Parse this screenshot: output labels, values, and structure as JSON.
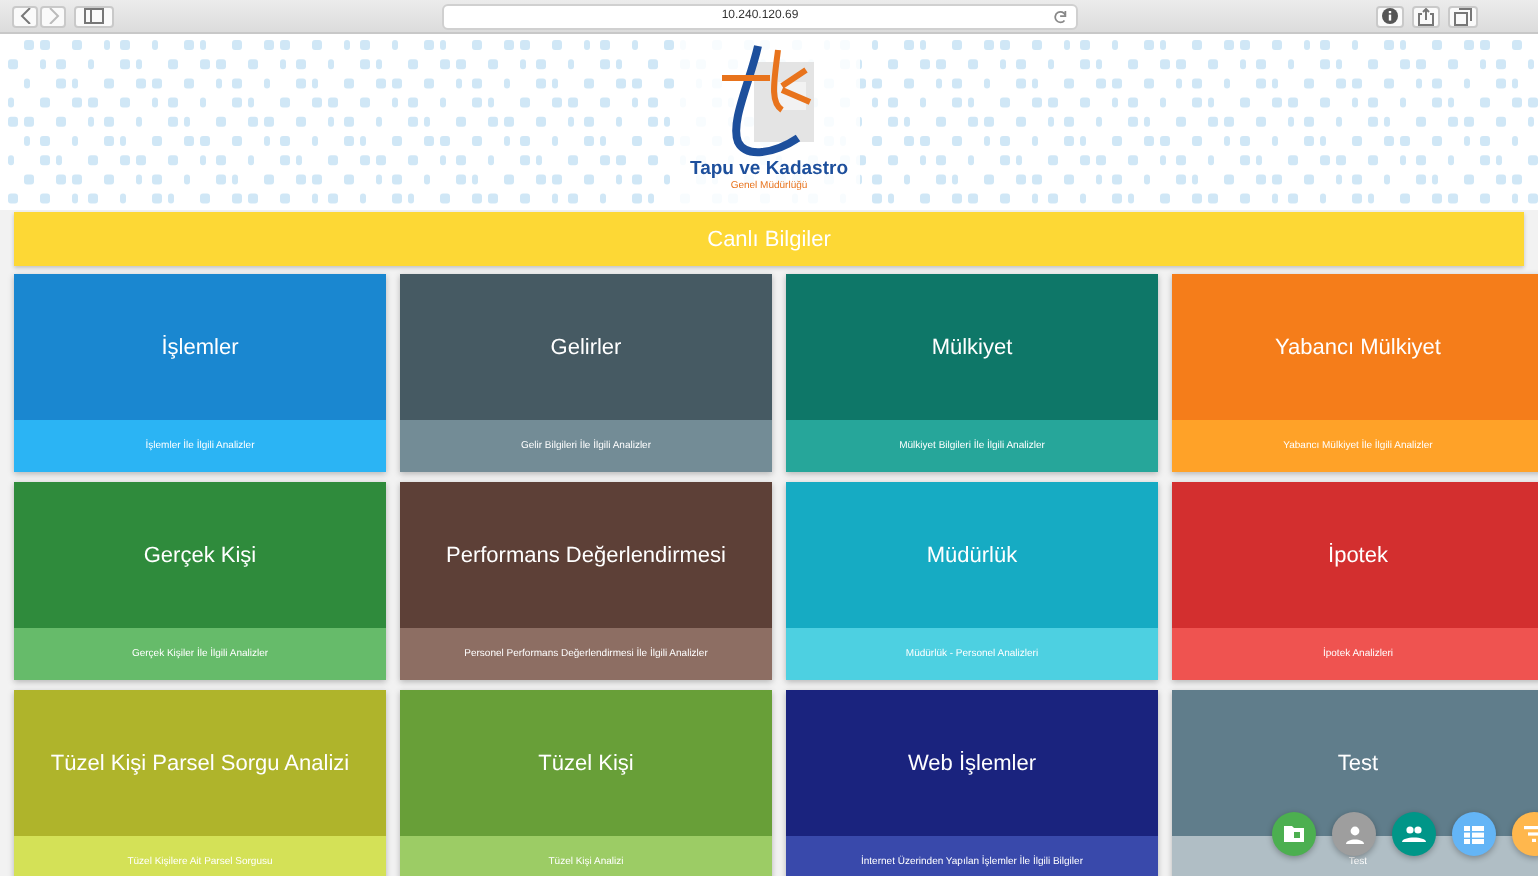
{
  "browser": {
    "url": "10.240.120.69"
  },
  "header": {
    "logo_title": "Tapu ve Kadastro",
    "logo_subtitle": "Genel Müdürlüğü"
  },
  "live_bar": {
    "label": "Canlı Bilgiler"
  },
  "tiles": [
    {
      "title": "İşlemler",
      "color": "#1a87d0",
      "footer": {
        "subtitle": "İşlemler İle İlgili Analizler",
        "color": "#2bb4f4"
      }
    },
    {
      "title": "Gelirler",
      "color": "#465a63",
      "footer": {
        "subtitle": "Gelir Bilgileri İle İlgili Analizler",
        "color": "#738c96"
      }
    },
    {
      "title": "Mülkiyet",
      "color": "#0e7768",
      "footer": {
        "subtitle": "Mülkiyet Bilgileri İle İlgili Analizler",
        "color": "#26a69a"
      }
    },
    {
      "title": "Yabancı Mülkiyet",
      "color": "#f57d1a",
      "footer": {
        "subtitle": "Yabancı Mülkiyet İle İlgili Analizler",
        "color": "#ffa228"
      }
    },
    {
      "title": "Gerçek Kişi",
      "color": "#2f8b3c",
      "footer": {
        "subtitle": "Gerçek Kişiler İle İlgili Analizler",
        "color": "#66bb6a"
      }
    },
    {
      "title": "Performans Değerlendirmesi",
      "color": "#5d4037",
      "footer": {
        "subtitle": "Personel Performans Değerlendirmesi İle İlgili Analizler",
        "color": "#8d6e63"
      }
    },
    {
      "title": "Müdürlük",
      "color": "#16abc3",
      "footer": {
        "subtitle": "Müdürlük - Personel Analizleri",
        "color": "#4dd0e1"
      }
    },
    {
      "title": "İpotek",
      "color": "#d32f2f",
      "footer": {
        "subtitle": "İpotek Analizleri",
        "color": "#ef5350"
      }
    },
    {
      "title": "Tüzel Kişi Parsel Sorgu Analizi",
      "color": "#afb42b",
      "footer": {
        "subtitle": "Tüzel Kişilere Ait Parsel Sorgusu",
        "color": "#d4e157"
      }
    },
    {
      "title": "Tüzel Kişi",
      "color": "#689f38",
      "footer": {
        "subtitle": "Tüzel Kişi Analizi",
        "color": "#9ccc65"
      }
    },
    {
      "title": "Web İşlemler",
      "color": "#1a237e",
      "footer": {
        "subtitle": "İnternet Üzerinden Yapılan İşlemler İle İlgili Bilgiler",
        "color": "#3949ab"
      }
    },
    {
      "title": "Test",
      "color": "#607d8b",
      "footer": {
        "subtitle": "Test",
        "color": "#b0bec5"
      }
    }
  ],
  "fabs": [
    {
      "color": "#4caf50"
    },
    {
      "color": "#9e9e9e"
    },
    {
      "color": "#009688"
    },
    {
      "color": "#64b5f6"
    },
    {
      "color": "#ffb74d"
    }
  ]
}
